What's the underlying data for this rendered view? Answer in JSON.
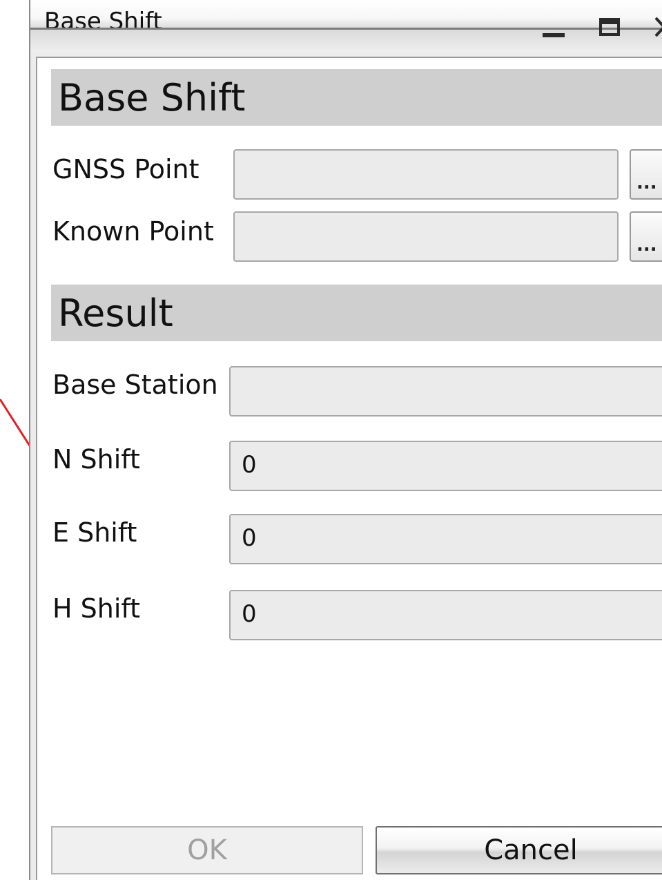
{
  "window": {
    "title": "Base Shift",
    "controls": {
      "minimize": "minimize-icon",
      "maximize": "maximize-icon",
      "close": "close-icon"
    }
  },
  "sections": {
    "input_header": "Base Shift",
    "result_header": "Result"
  },
  "fields": {
    "gnss_point": {
      "label": "GNSS Point",
      "value": "",
      "browse_label": "..."
    },
    "known_point": {
      "label": "Known Point",
      "value": "",
      "browse_label": "..."
    },
    "base_station": {
      "label": "Base Station",
      "value": ""
    },
    "n_shift": {
      "label": "N Shift",
      "value": "0"
    },
    "e_shift": {
      "label": "E Shift",
      "value": "0"
    },
    "h_shift": {
      "label": "H Shift",
      "value": "0"
    }
  },
  "buttons": {
    "ok": "OK",
    "cancel": "Cancel"
  },
  "colors": {
    "section_header_bg": "#cfcfcf",
    "input_bg": "#ebebeb",
    "annotation_line": "#e02020"
  }
}
